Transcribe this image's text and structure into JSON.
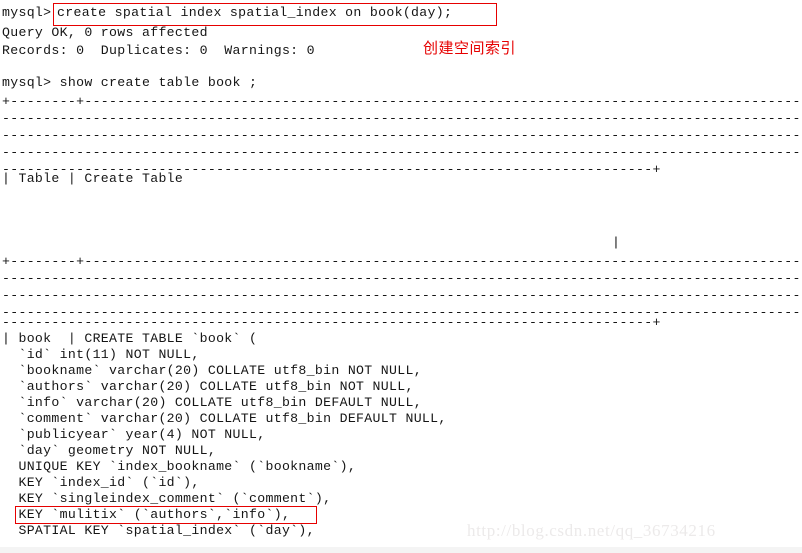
{
  "terminal": {
    "prompt": "mysql>",
    "command_1": "create spatial index spatial_index on book(day);",
    "result_line_1": "Query OK, 0 rows affected",
    "result_line_2": "Records: 0  Duplicates: 0  Warnings: 0",
    "command_2_full": "mysql> show create table book ;",
    "separator_first": "+--------+-----------------------------------------------------------------------------------------------",
    "separator_fill": "-----------------------------------------------------------------------------------------------------",
    "separator_last": "-------------------------------------------------------------------------------+",
    "column_header_row": "| Table | Create Table",
    "pipe_marker": "|",
    "create_table": [
      "| book  | CREATE TABLE `book` (",
      "  `id` int(11) NOT NULL,",
      "  `bookname` varchar(20) COLLATE utf8_bin NOT NULL,",
      "  `authors` varchar(20) COLLATE utf8_bin NOT NULL,",
      "  `info` varchar(20) COLLATE utf8_bin DEFAULT NULL,",
      "  `comment` varchar(20) COLLATE utf8_bin DEFAULT NULL,",
      "  `publicyear` year(4) NOT NULL,",
      "  `day` geometry NOT NULL,",
      "  UNIQUE KEY `index_bookname` (`bookname`),",
      "  KEY `index_id` (`id`),",
      "  KEY `singleindex_comment` (`comment`),",
      "  KEY `mulitix` (`authors`,`info`),",
      "  SPATIAL KEY `spatial_index` (`day`),"
    ]
  },
  "annotations": {
    "spatial_index_note": "创建空间索引",
    "highlight_color": "#e60000"
  },
  "watermark": {
    "text": "http://blog.csdn.net/qq_36734216"
  }
}
